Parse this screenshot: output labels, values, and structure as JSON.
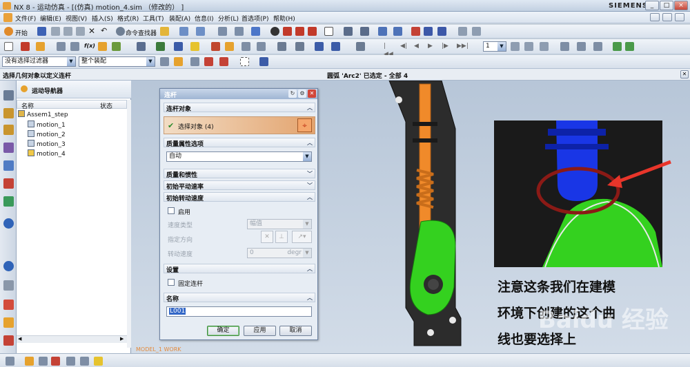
{
  "window": {
    "title": "NX 8 - 运动仿真 - [(仿真) motion_4.sim （修改的） ]",
    "brand": "SIEMENS",
    "controls": [
      "_",
      "□",
      "×"
    ]
  },
  "menu": {
    "items": [
      "文件(F)",
      "编辑(E)",
      "视图(V)",
      "插入(S)",
      "格式(R)",
      "工具(T)",
      "装配(A)",
      "信息(I)",
      "分析(L)",
      "首选项(P)",
      "帮助(H)"
    ]
  },
  "toolbar1": {
    "start_label": "开始",
    "command_finder_label": "命令查找器"
  },
  "toolbar2": {
    "page_value": "1"
  },
  "filterbar": {
    "filter_value": "没有选择过滤器",
    "assembly_value": "整个装配"
  },
  "cue": {
    "left": "选择几何对象以定义连杆",
    "center": "圆弧 'Arc2' 已选定 - 全部 4"
  },
  "navigator": {
    "title": "运动导航器",
    "col_name": "名称",
    "col_status": "状态",
    "root": "Assem1_step",
    "children": [
      "motion_1",
      "motion_2",
      "motion_3",
      "motion_4"
    ]
  },
  "dialog": {
    "title": "连杆",
    "group_link_object": "连杆对象",
    "select_object": "选择对象 (4)",
    "group_mass_options": "质量属性选项",
    "mass_option_value": "自动",
    "group_mass_inertia": "质量和惯性",
    "group_init_trans": "初始平动速率",
    "group_init_rot": "初始转动速度",
    "enable_label": "启用",
    "speed_type_label": "速度类型",
    "speed_type_value": "幅值",
    "direction_label": "指定方向",
    "rot_speed_label": "转动速度",
    "rot_speed_value": "0",
    "rot_speed_unit": "degr",
    "group_settings": "设置",
    "fix_link_label": "固定连杆",
    "group_name": "名称",
    "name_value": "L001",
    "ok_label": "确定",
    "apply_label": "应用",
    "cancel_label": "取消"
  },
  "viewport": {
    "watermark": "MODEL_1 WORK",
    "annotation_lines": [
      "注意这条我们在建模",
      "环境下创建的这个曲",
      "线也要选择上"
    ],
    "baidu_mark": "Baidu 经验"
  },
  "colors": {
    "green_part": "#34d11f",
    "blue_part": "#1936e6",
    "orange_part": "#f08a2a",
    "annot_circle": "#8b1a16",
    "annot_arrow": "#e8352a"
  }
}
